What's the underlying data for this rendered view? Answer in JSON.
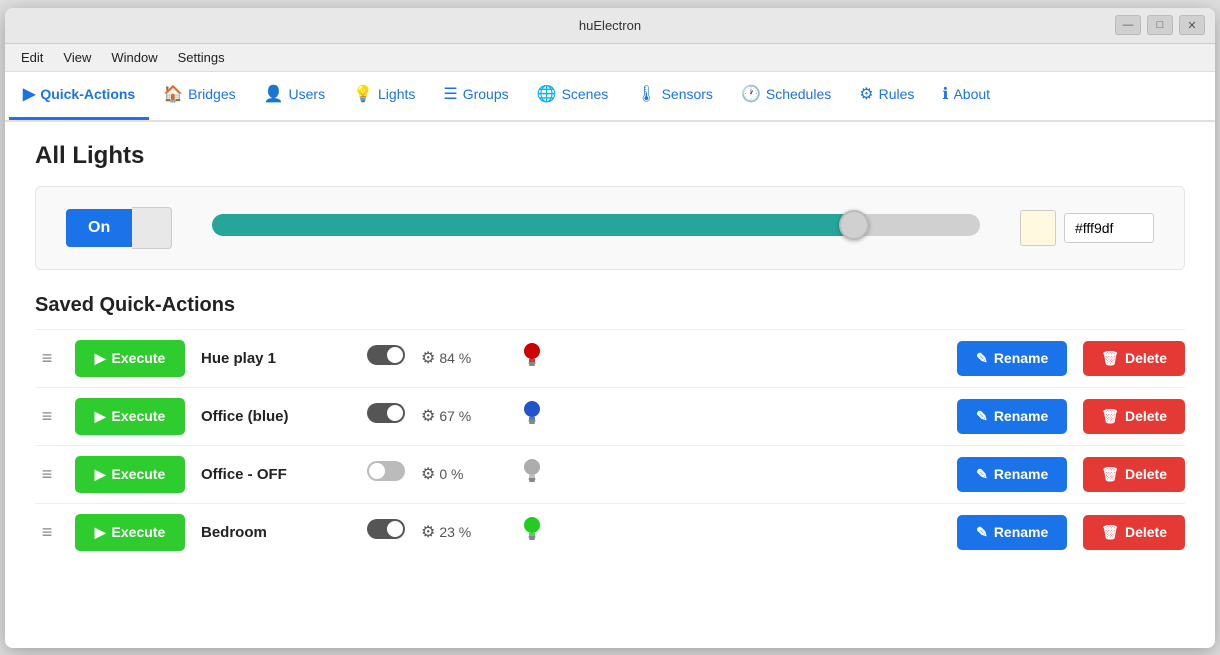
{
  "window": {
    "title": "huElectron",
    "controls": [
      "minimize",
      "maximize",
      "close"
    ]
  },
  "menu": {
    "items": [
      "Edit",
      "View",
      "Window",
      "Settings"
    ]
  },
  "nav": {
    "items": [
      {
        "id": "quick-actions",
        "label": "Quick-Actions",
        "icon": "▶",
        "active": true
      },
      {
        "id": "bridges",
        "label": "Bridges",
        "icon": "🏠"
      },
      {
        "id": "users",
        "label": "Users",
        "icon": "👤"
      },
      {
        "id": "lights",
        "label": "Lights",
        "icon": "💡"
      },
      {
        "id": "groups",
        "label": "Groups",
        "icon": "☰"
      },
      {
        "id": "scenes",
        "label": "Scenes",
        "icon": "🌐"
      },
      {
        "id": "sensors",
        "label": "Sensors",
        "icon": "🌡"
      },
      {
        "id": "schedules",
        "label": "Schedules",
        "icon": "🕐"
      },
      {
        "id": "rules",
        "label": "Rules",
        "icon": "⚙"
      },
      {
        "id": "about",
        "label": "About",
        "icon": "ℹ"
      }
    ]
  },
  "page": {
    "title": "All Lights"
  },
  "control_panel": {
    "toggle_label": "On",
    "brightness_value": 85,
    "color_hex": "#fff9df",
    "color_input_value": "#fff9df"
  },
  "saved_section": {
    "title": "Saved Quick-Actions"
  },
  "actions": [
    {
      "name": "Hue play 1",
      "toggle": true,
      "brightness": "84 %",
      "bulb_color": "#cc0000",
      "execute_label": "Execute",
      "rename_label": "Rename",
      "delete_label": "Delete"
    },
    {
      "name": "Office (blue)",
      "toggle": true,
      "brightness": "67 %",
      "bulb_color": "#2255cc",
      "execute_label": "Execute",
      "rename_label": "Rename",
      "delete_label": "Delete"
    },
    {
      "name": "Office - OFF",
      "toggle": false,
      "brightness": "0 %",
      "bulb_color": "#333333",
      "execute_label": "Execute",
      "rename_label": "Rename",
      "delete_label": "Delete"
    },
    {
      "name": "Bedroom",
      "toggle": true,
      "brightness": "23 %",
      "bulb_color": "#22cc22",
      "execute_label": "Execute",
      "rename_label": "Rename",
      "delete_label": "Delete"
    }
  ],
  "icons": {
    "minimize": "—",
    "maximize": "□",
    "close": "✕",
    "play": "▶",
    "pencil": "✎",
    "trash": "🗑",
    "drag": "≡",
    "toggle_on": "⏺",
    "toggle_off": "⏺",
    "gear": "⚙"
  }
}
